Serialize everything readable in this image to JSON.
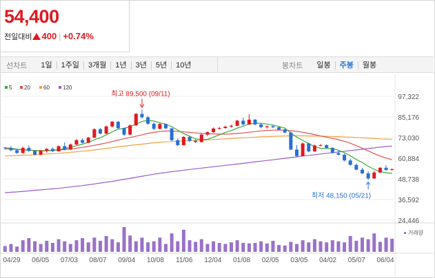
{
  "quote": {
    "price": "54,400",
    "change_label": "전일대비",
    "change_amount": "400",
    "change_percent": "+0.74%",
    "up_color": "#e0191f"
  },
  "tabs": {
    "line_title": "선차트",
    "line_items": [
      "1일",
      "1주일",
      "3개월",
      "1년",
      "3년",
      "5년",
      "10년"
    ],
    "candle_title": "봉차트",
    "candle_items": [
      "일봉",
      "주봉",
      "월봉"
    ],
    "active_candle": "주봉"
  },
  "chart_data": {
    "type": "candlestick",
    "legend": [
      {
        "name": "5",
        "color": "#3aa83a"
      },
      {
        "name": "20",
        "color": "#e05050"
      },
      {
        "name": "60",
        "color": "#f0a040"
      },
      {
        "name": "120",
        "color": "#9a5ac8"
      }
    ],
    "y_ticks": [
      "97,322",
      "85,176",
      "73,030",
      "60,884",
      "48,738",
      "36,592",
      "24,446"
    ],
    "y_tick_values": [
      97322,
      85176,
      73030,
      60884,
      48738,
      36592,
      24446
    ],
    "ylim": [
      24446,
      97322
    ],
    "x_ticks": [
      "04/29",
      "06/05",
      "07/03",
      "08/07",
      "09/04",
      "10/08",
      "11/06",
      "12/04",
      "01/08",
      "02/05",
      "03/05",
      "04/02",
      "05/07",
      "06/04"
    ],
    "high_annotation": "최고 89,500 (09/11)",
    "low_annotation": "최저 48,150 (05/21)",
    "volume_label": "거래량",
    "up_color": "#e0191f",
    "down_color": "#2a6fd4",
    "candles": [
      [
        67200,
        67500,
        66000,
        66800
      ],
      [
        66800,
        68200,
        65000,
        65600
      ],
      [
        65600,
        66500,
        63500,
        64000
      ],
      [
        64000,
        67800,
        63600,
        67000
      ],
      [
        67000,
        68500,
        64600,
        65200
      ],
      [
        65200,
        65500,
        62500,
        63000
      ],
      [
        63000,
        65600,
        62600,
        65200
      ],
      [
        65200,
        66800,
        64200,
        66400
      ],
      [
        66400,
        67200,
        64600,
        65000
      ],
      [
        65000,
        68500,
        64800,
        68000
      ],
      [
        68000,
        70200,
        65500,
        66000
      ],
      [
        66000,
        69500,
        65800,
        69000
      ],
      [
        69000,
        72000,
        68600,
        71600
      ],
      [
        71600,
        72600,
        69600,
        70000
      ],
      [
        70000,
        73500,
        69800,
        73000
      ],
      [
        73000,
        78500,
        72800,
        78000
      ],
      [
        78000,
        78800,
        75000,
        75400
      ],
      [
        75400,
        80200,
        75000,
        79600
      ],
      [
        79600,
        82800,
        79000,
        82400
      ],
      [
        82400,
        82800,
        78000,
        78600
      ],
      [
        78600,
        79000,
        74000,
        74800
      ],
      [
        74800,
        80800,
        74600,
        80200
      ],
      [
        80200,
        87500,
        80000,
        87000
      ],
      [
        87000,
        89500,
        84200,
        85000
      ],
      [
        85000,
        85800,
        80600,
        81200
      ],
      [
        81200,
        82000,
        77500,
        78200
      ],
      [
        78200,
        81600,
        77800,
        81000
      ],
      [
        81000,
        81300,
        78000,
        78500
      ],
      [
        78500,
        78600,
        71000,
        71500
      ],
      [
        71500,
        72600,
        68200,
        68600
      ],
      [
        68600,
        74000,
        68400,
        73400
      ],
      [
        73400,
        74200,
        70400,
        71200
      ],
      [
        71200,
        72000,
        69800,
        70400
      ],
      [
        70400,
        75300,
        70200,
        74800
      ],
      [
        74800,
        76700,
        73900,
        76200
      ],
      [
        76200,
        79000,
        75800,
        78400
      ],
      [
        78400,
        79300,
        77600,
        78700
      ],
      [
        78700,
        80000,
        78200,
        79500
      ],
      [
        79500,
        80600,
        79000,
        80000
      ],
      [
        80000,
        83500,
        79700,
        83000
      ],
      [
        83000,
        84800,
        80200,
        80800
      ],
      [
        80800,
        86800,
        80600,
        83600
      ],
      [
        83600,
        84000,
        80200,
        80800
      ],
      [
        80800,
        81500,
        78500,
        79200
      ],
      [
        79200,
        80200,
        78300,
        79700
      ],
      [
        79700,
        80300,
        78600,
        79100
      ],
      [
        79100,
        79500,
        77400,
        77800
      ],
      [
        77800,
        78300,
        75600,
        76000
      ],
      [
        76000,
        76500,
        65600,
        66000
      ],
      [
        66000,
        68600,
        61600,
        62200
      ],
      [
        62200,
        70200,
        61900,
        69600
      ],
      [
        69600,
        70000,
        64400,
        64900
      ],
      [
        64900,
        68900,
        64700,
        68400
      ],
      [
        68400,
        69300,
        67900,
        68600
      ],
      [
        68600,
        69100,
        66500,
        67000
      ],
      [
        67000,
        67400,
        63600,
        64000
      ],
      [
        64000,
        65800,
        62600,
        63000
      ],
      [
        63000,
        63600,
        59000,
        59600
      ],
      [
        59600,
        60600,
        56600,
        57000
      ],
      [
        57000,
        57800,
        53800,
        54200
      ],
      [
        54200,
        55200,
        51600,
        52000
      ],
      [
        52000,
        53200,
        48150,
        49000
      ],
      [
        49000,
        53500,
        48800,
        52500
      ],
      [
        52500,
        55700,
        52200,
        55300
      ],
      [
        55300,
        56800,
        53400,
        54000
      ],
      [
        54000,
        55000,
        53600,
        54400
      ]
    ],
    "ma5": [
      67000,
      66800,
      66200,
      65800,
      65600,
      65400,
      65200,
      65300,
      65500,
      66000,
      66500,
      67500,
      68300,
      69200,
      70200,
      71800,
      73000,
      74600,
      76400,
      78000,
      78500,
      79500,
      81000,
      82600,
      83200,
      82800,
      81700,
      81000,
      79500,
      77500,
      75400,
      73800,
      72300,
      71900,
      72000,
      73300,
      74700,
      76100,
      77200,
      78600,
      79800,
      81000,
      81500,
      81500,
      81000,
      80400,
      79600,
      78600,
      75800,
      73300,
      71400,
      69500,
      67800,
      66700,
      66600,
      66600,
      65600,
      64200,
      62400,
      60200,
      58400,
      56200,
      54400,
      53000,
      52400,
      52000
    ],
    "ma20": [
      66400,
      66300,
      66100,
      65900,
      65700,
      65500,
      65400,
      65400,
      65500,
      65700,
      66000,
      66400,
      66800,
      67300,
      67900,
      68500,
      69200,
      69900,
      70700,
      71600,
      72400,
      73100,
      73900,
      74700,
      75500,
      76100,
      76600,
      76900,
      76900,
      76700,
      76400,
      76100,
      75800,
      75500,
      75300,
      75200,
      75100,
      75100,
      75200,
      75500,
      75800,
      76200,
      76600,
      77000,
      77300,
      77400,
      77500,
      77400,
      77100,
      76700,
      76200,
      75500,
      74800,
      74000,
      73300,
      72600,
      71800,
      70900,
      69700,
      68300,
      66800,
      65200,
      63600,
      62200,
      61000,
      60000
    ],
    "ma60": [
      62200,
      62400,
      62500,
      62700,
      62800,
      63000,
      63200,
      63400,
      63600,
      63800,
      64100,
      64400,
      64700,
      65000,
      65400,
      65800,
      66200,
      66700,
      67100,
      67600,
      68000,
      68400,
      68800,
      69200,
      69600,
      70000,
      70300,
      70500,
      70700,
      70900,
      71100,
      71200,
      71400,
      71500,
      71700,
      71900,
      72100,
      72300,
      72500,
      72700,
      72900,
      73100,
      73300,
      73500,
      73600,
      73800,
      73900,
      74000,
      74100,
      74100,
      74100,
      74000,
      74000,
      73900,
      73800,
      73700,
      73600,
      73400,
      73300,
      73100,
      72900,
      72700,
      72500,
      72300,
      72200,
      72100
    ],
    "ma120": [
      40600,
      40900,
      41100,
      41400,
      41700,
      42000,
      42300,
      42600,
      42900,
      43200,
      43600,
      44000,
      44400,
      44800,
      45300,
      45800,
      46300,
      46800,
      47300,
      47900,
      48500,
      49100,
      49700,
      50300,
      50900,
      51500,
      52000,
      52500,
      53000,
      53400,
      53900,
      54300,
      54700,
      55100,
      55500,
      55900,
      56300,
      56700,
      57100,
      57500,
      57900,
      58300,
      58800,
      59200,
      59600,
      60000,
      60400,
      60900,
      61300,
      61700,
      62200,
      62600,
      63000,
      63400,
      63800,
      64200,
      64600,
      65000,
      65400,
      65800,
      66200,
      66600,
      67000,
      67400,
      67800,
      68100
    ],
    "volume": [
      0.22,
      0.3,
      0.2,
      0.44,
      0.52,
      0.4,
      0.3,
      0.42,
      0.34,
      0.48,
      0.4,
      0.3,
      0.44,
      0.52,
      0.36,
      0.54,
      0.42,
      0.6,
      0.48,
      0.36,
      0.94,
      0.62,
      0.4,
      0.54,
      0.36,
      0.4,
      0.54,
      0.3,
      0.7,
      0.4,
      0.84,
      0.44,
      0.38,
      0.48,
      0.3,
      0.4,
      0.34,
      0.3,
      0.36,
      0.44,
      0.34,
      0.32,
      0.34,
      0.4,
      0.32,
      0.42,
      0.26,
      0.24,
      0.38,
      0.3,
      0.44,
      0.36,
      0.48,
      0.4,
      0.36,
      0.44,
      0.4,
      0.36,
      0.6,
      0.42,
      0.54,
      0.48,
      0.7,
      0.38,
      0.54,
      0.5
    ]
  }
}
